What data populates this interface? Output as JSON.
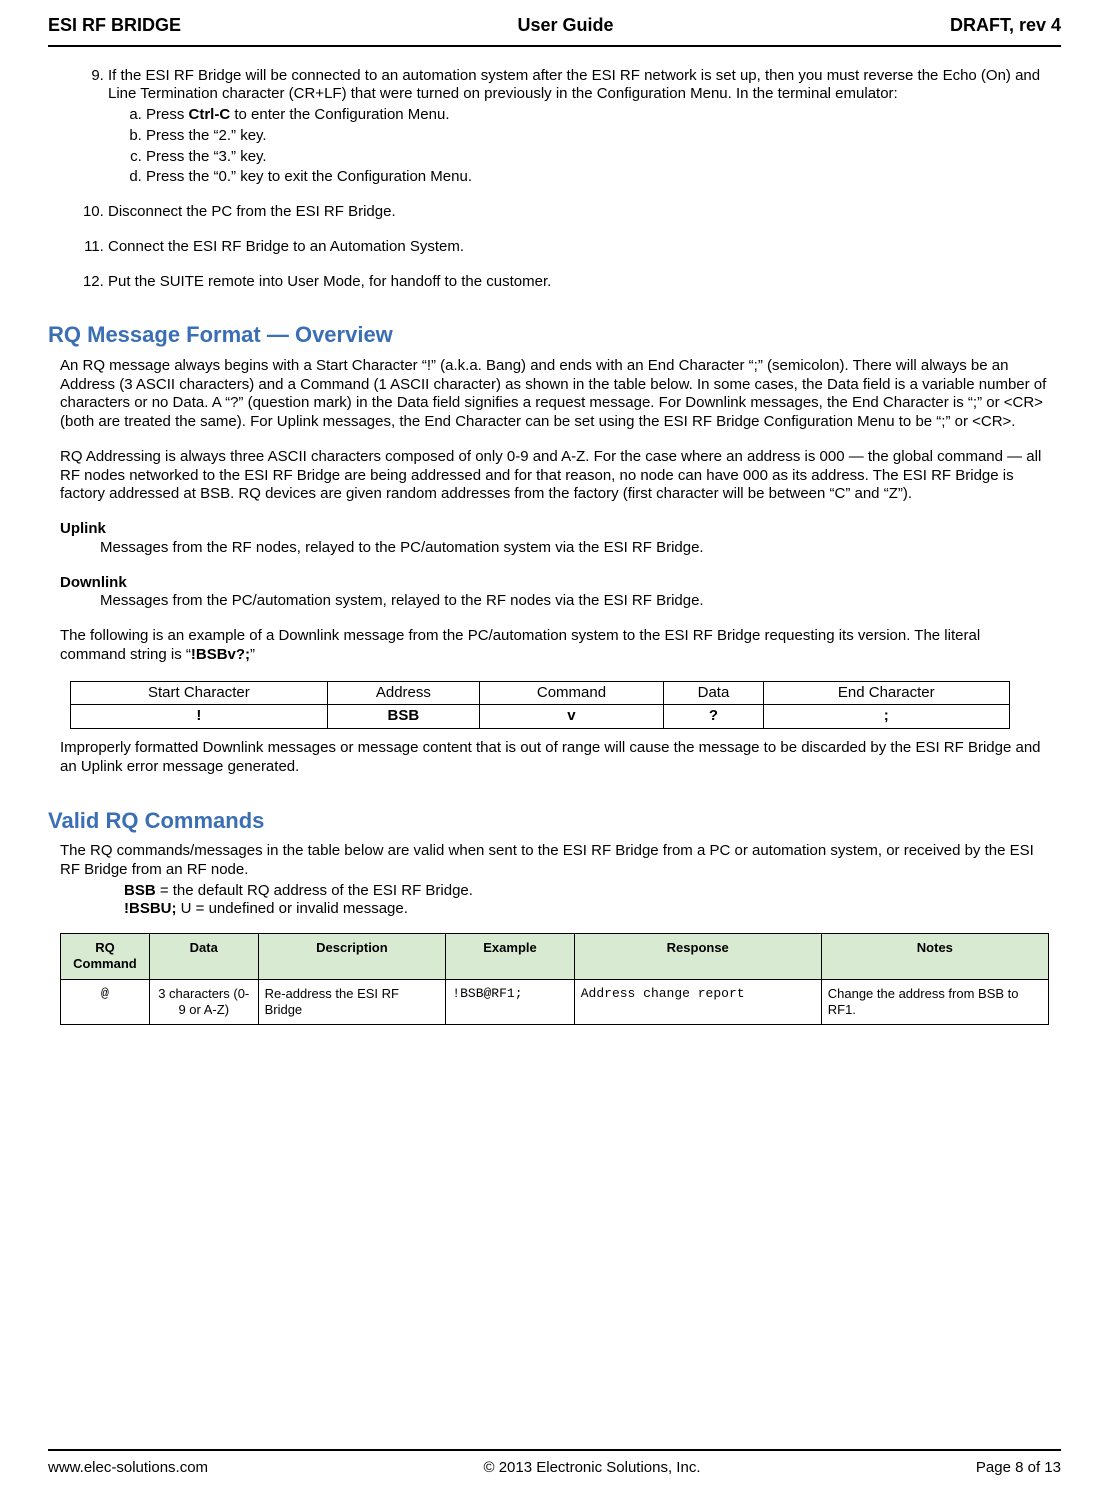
{
  "header": {
    "left": "ESI RF BRIDGE",
    "center": "User Guide",
    "right": "DRAFT, rev 4"
  },
  "steps": {
    "nine": {
      "num": "9.",
      "text_a": "If the ESI RF Bridge will be connected to an automation system after the ESI RF network is set up, then you must reverse the Echo (On) and Line Termination character (CR+LF) that were turned on previously in the Configuration Menu. In the terminal emulator:",
      "sub": {
        "a_pre": "Press ",
        "a_bold": "Ctrl-C",
        "a_post": " to enter the Configuration Menu.",
        "b": "Press the “2.” key.",
        "c": "Press the “3.” key.",
        "d": "Press the “0.” key to exit the Configuration Menu."
      }
    },
    "ten": {
      "num": "10.",
      "text": "Disconnect the PC from the ESI RF Bridge."
    },
    "eleven": {
      "num": "11.",
      "text": "Connect the ESI RF Bridge to an Automation System."
    },
    "twelve": {
      "num": "12.",
      "text": "Put the SUITE remote into User Mode, for handoff to the customer."
    }
  },
  "section_rq_format": {
    "heading": "RQ Message Format — Overview",
    "p1": "An RQ message always begins with a Start Character “!” (a.k.a. Bang) and ends with an End Character “;” (semicolon). There will always be an Address (3 ASCII characters) and a Command (1 ASCII character) as shown in the table below. In some cases, the Data field is a variable number of characters or no Data. A “?” (question mark) in the Data field signifies a request message. For Downlink messages, the End Character is “;” or <CR> (both are treated the same). For Uplink messages, the End Character can be set using the ESI RF Bridge Configuration Menu to be “;” or <CR>.",
    "p2": "RQ Addressing is always three ASCII characters composed of only 0-9 and A-Z. For the case where an address is 000 — the global command — all RF nodes networked to the ESI RF Bridge are being addressed and for that reason, no node can have 000 as its address. The ESI RF Bridge is factory addressed at BSB. RQ devices are given random addresses from the factory (first character will be between “C” and “Z”).",
    "uplink_term": "Uplink",
    "uplink_body": "Messages from the RF nodes, relayed to the PC/automation system via the ESI RF Bridge.",
    "downlink_term": "Downlink",
    "downlink_body": "Messages from the PC/automation system, relayed to the RF nodes via the ESI RF Bridge.",
    "p3_pre": "The following is an example of a Downlink message from the PC/automation system to the ESI RF Bridge requesting its version. The literal command string is “",
    "p3_bold": "!BSBv?;",
    "p3_post": "”",
    "table": {
      "h1": "Start Character",
      "h2": "Address",
      "h3": "Command",
      "h4": "Data",
      "h5": "End Character",
      "v1": "!",
      "v2": "BSB",
      "v3": "v",
      "v4": "?",
      "v5": ";"
    },
    "p4": "Improperly formatted Downlink messages or message content that is out of range will cause the message to be discarded by the ESI RF Bridge and an Uplink error message generated."
  },
  "section_valid": {
    "heading": "Valid RQ Commands",
    "intro": "The RQ commands/messages in the table below are valid when sent to the ESI RF Bridge from a PC or automation system, or received by the ESI RF Bridge from an RF node.",
    "line1_bold": "BSB",
    "line1_rest": " = the default RQ address of the ESI RF Bridge.",
    "line2_bold": "!BSBU;",
    "line2_rest": " U = undefined or invalid message.",
    "table": {
      "h1": "RQ Command",
      "h2": "Data",
      "h3": "Description",
      "h4": "Example",
      "h5": "Response",
      "h6": "Notes",
      "r1c1": "@",
      "r1c2": "3 characters (0-9 or A-Z)",
      "r1c3": "Re-address the ESI RF Bridge",
      "r1c4": "!BSB@RF1;",
      "r1c5": "Address change report",
      "r1c6": "Change the address from BSB to RF1."
    }
  },
  "footer": {
    "left": "www.elec-solutions.com",
    "center": "© 2013 Electronic Solutions, Inc.",
    "right": "Page 8 of 13"
  }
}
